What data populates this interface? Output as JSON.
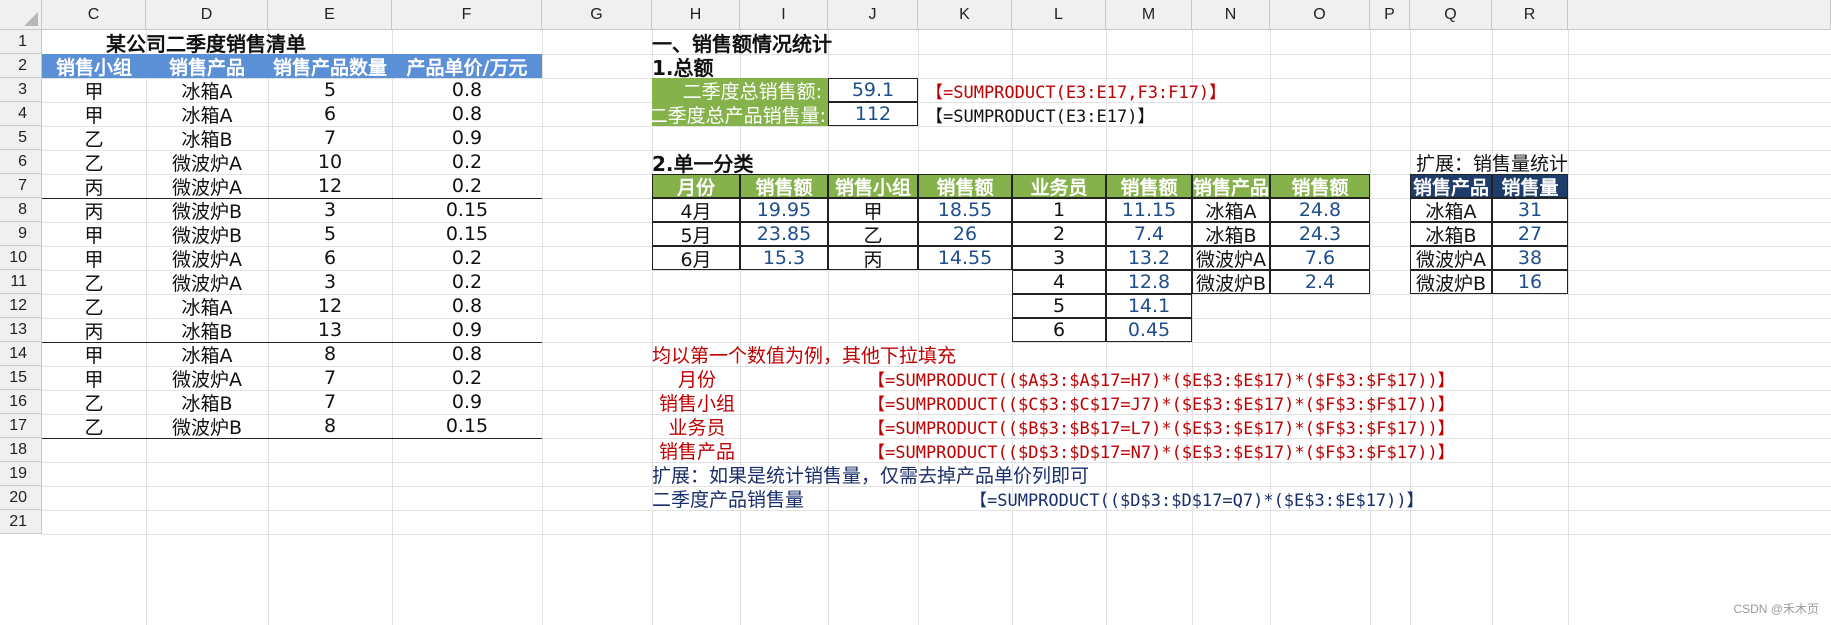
{
  "columns": [
    "C",
    "D",
    "E",
    "F",
    "G",
    "H",
    "I",
    "J",
    "K",
    "L",
    "M",
    "N",
    "O",
    "P",
    "Q",
    "R"
  ],
  "rows": [
    "1",
    "2",
    "3",
    "4",
    "5",
    "6",
    "7",
    "8",
    "9",
    "10",
    "11",
    "12",
    "13",
    "14",
    "15",
    "16",
    "17",
    "18",
    "19",
    "20",
    "21"
  ],
  "sales_list": {
    "title": "某公司二季度销售清单",
    "headers": [
      "销售小组",
      "销售产品",
      "销售产品数量",
      "产品单价/万元"
    ],
    "rows": [
      [
        "甲",
        "冰箱A",
        "5",
        "0.8"
      ],
      [
        "甲",
        "冰箱A",
        "6",
        "0.8"
      ],
      [
        "乙",
        "冰箱B",
        "7",
        "0.9"
      ],
      [
        "乙",
        "微波炉A",
        "10",
        "0.2"
      ],
      [
        "丙",
        "微波炉A",
        "12",
        "0.2"
      ],
      [
        "丙",
        "微波炉B",
        "3",
        "0.15"
      ],
      [
        "甲",
        "微波炉B",
        "5",
        "0.15"
      ],
      [
        "甲",
        "微波炉A",
        "6",
        "0.2"
      ],
      [
        "乙",
        "微波炉A",
        "3",
        "0.2"
      ],
      [
        "乙",
        "冰箱A",
        "12",
        "0.8"
      ],
      [
        "丙",
        "冰箱B",
        "13",
        "0.9"
      ],
      [
        "甲",
        "冰箱A",
        "8",
        "0.8"
      ],
      [
        "甲",
        "微波炉A",
        "7",
        "0.2"
      ],
      [
        "乙",
        "冰箱B",
        "7",
        "0.9"
      ],
      [
        "乙",
        "微波炉B",
        "8",
        "0.15"
      ]
    ]
  },
  "stats": {
    "section_title": "一、销售额情况统计",
    "total_title": "1.总额",
    "total_amount_label": "二季度总销售额:",
    "total_amount_value": "59.1",
    "total_amount_formula": "【=SUMPRODUCT(E3:E17,F3:F17)】",
    "total_qty_label": "二季度总产品销售量:",
    "total_qty_value": "112",
    "total_qty_formula": "【=SUMPRODUCT(E3:E17)】",
    "category_title": "2.单一分类",
    "category_headers": [
      "月份",
      "销售额",
      "销售小组",
      "销售额",
      "业务员",
      "销售额",
      "销售产品",
      "销售额"
    ],
    "by_month": [
      [
        "4月",
        "19.95"
      ],
      [
        "5月",
        "23.85"
      ],
      [
        "6月",
        "15.3"
      ]
    ],
    "by_group": [
      [
        "甲",
        "18.55"
      ],
      [
        "乙",
        "26"
      ],
      [
        "丙",
        "14.55"
      ]
    ],
    "by_salesperson": [
      [
        "1",
        "11.15"
      ],
      [
        "2",
        "7.4"
      ],
      [
        "3",
        "13.2"
      ],
      [
        "4",
        "12.8"
      ],
      [
        "5",
        "14.1"
      ],
      [
        "6",
        "0.45"
      ]
    ],
    "by_product": [
      [
        "冰箱A",
        "24.8"
      ],
      [
        "冰箱B",
        "24.3"
      ],
      [
        "微波炉A",
        "7.6"
      ],
      [
        "微波炉B",
        "2.4"
      ]
    ],
    "note": "均以第一个数值为例，其他下拉填充",
    "formulas": [
      [
        "月份",
        "【=SUMPRODUCT(($A$3:$A$17=H7)*($E$3:$E$17)*($F$3:$F$17))】"
      ],
      [
        "销售小组",
        "【=SUMPRODUCT(($C$3:$C$17=J7)*($E$3:$E$17)*($F$3:$F$17))】"
      ],
      [
        "业务员",
        "【=SUMPRODUCT(($B$3:$B$17=L7)*($E$3:$E$17)*($F$3:$F$17))】"
      ],
      [
        "销售产品",
        "【=SUMPRODUCT(($D$3:$D$17=N7)*($E$3:$E$17)*($F$3:$F$17))】"
      ]
    ],
    "ext_note": "扩展：如果是统计销售量，仅需去掉产品单价列即可",
    "ext_qty_label": "二季度产品销售量",
    "ext_qty_formula": "【=SUMPRODUCT(($D$3:$D$17=Q7)*($E$3:$E$17))】"
  },
  "extension": {
    "title": "扩展：销售量统计",
    "headers": [
      "销售产品",
      "销售量"
    ],
    "rows": [
      [
        "冰箱A",
        "31"
      ],
      [
        "冰箱B",
        "27"
      ],
      [
        "微波炉A",
        "38"
      ],
      [
        "微波炉B",
        "16"
      ]
    ]
  },
  "watermark": "CSDN @禾木页",
  "colors": {
    "blue_header": "#5b8fd6",
    "green_header": "#86b24b",
    "navy_header": "#1f3d6b",
    "formula_red": "#c00000",
    "value_blue": "#1f4e8c"
  }
}
